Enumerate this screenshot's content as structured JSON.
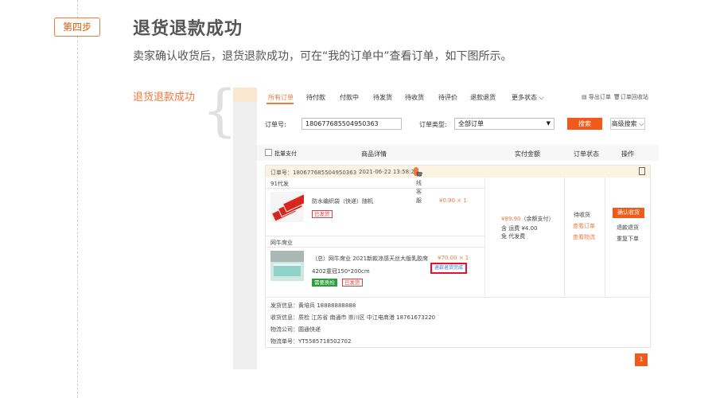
{
  "step": {
    "badge": "第四步",
    "title": "退货退款成功",
    "description": "卖家确认收货后，退货退款成功，可在“我的订单中”查看订单，如下图所示。",
    "side_label": "退货退款成功"
  },
  "tabs": [
    "所有订单",
    "待付款",
    "付款中",
    "待发货",
    "待收货",
    "待评价",
    "退款退货",
    "更多状态"
  ],
  "tab_actions": [
    "导出订单",
    "订单回收站"
  ],
  "search": {
    "order_no_label": "订单号:",
    "order_no_value": "180677685504950363",
    "order_type_label": "订单类型:",
    "order_type_value": "全部订单",
    "search_button": "搜索",
    "advanced_button": "高级搜索"
  },
  "table_header": {
    "batch_pay": "批量支付",
    "product_detail": "商品详情",
    "paid_amount": "实付金额",
    "order_status": "订单状态",
    "operation": "操作"
  },
  "order": {
    "header_no": "订单号：180677685504950363",
    "header_time": "2021-06-22 13:58:25",
    "kefu": "在线客服",
    "supplier1": "91代发",
    "item1_name": "防水编织袋（快递）随机",
    "item1_price": "¥0.90 × 1",
    "item1_tag": "已发货",
    "supplier2": "网牛席业",
    "item2_name": "（总）网牛席业 2021新款凉感天丝大版乳胶席",
    "item2_spec": "4202童冠150*200cm",
    "item2_price": "¥70.00 × 1",
    "item2_tag_green": "需要质检",
    "item2_tag_red": "已发货",
    "item2_refund": "退款退货完成",
    "total": "¥89.90",
    "total_note": "（余额支付）",
    "freight": "含 运费 ¥4.00",
    "service": "免 代发费",
    "status": "待收货",
    "view_order": "查看订单",
    "view_logistics": "查看物流",
    "confirm_button": "确认收货",
    "refund_link": "退款退货",
    "reorder_link": "重复下单",
    "sender": "发货信息：黄培兵 18888888888",
    "receiver": "收货信息：质检 江苏省 南通市 崇川区 中江电商港 18761673220",
    "logistics_company": "物流公司：圆通快递",
    "tracking_no": "物流单号：YT5585718502702"
  },
  "pagination": {
    "current": "1"
  },
  "colors": {
    "accent": "#f07a3a",
    "button": "#f05a1a",
    "highlight": "#e8102c"
  }
}
